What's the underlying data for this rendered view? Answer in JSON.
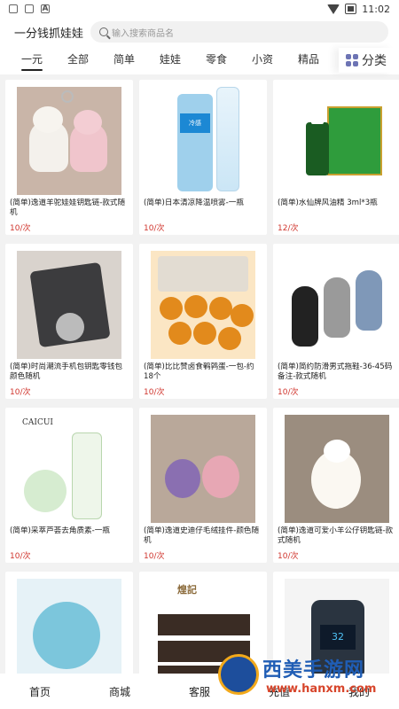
{
  "status_bar": {
    "time": "11:02"
  },
  "header": {
    "title": "一分钱抓娃娃",
    "search_placeholder": "输入搜索商品名"
  },
  "tabs": [
    {
      "label": "一元",
      "active": true
    },
    {
      "label": "全部",
      "active": false
    },
    {
      "label": "简单",
      "active": false
    },
    {
      "label": "娃娃",
      "active": false
    },
    {
      "label": "零食",
      "active": false
    },
    {
      "label": "小资",
      "active": false
    },
    {
      "label": "精品",
      "active": false
    }
  ],
  "category_button": {
    "label": "分类"
  },
  "products": [
    {
      "name": "(简单)逸道羊驼娃娃钥匙链-款式随机",
      "price": "10/次",
      "thumb": "alpaca"
    },
    {
      "name": "(简单)日本清凉降温喷雾-一瓶",
      "price": "10/次",
      "thumb": "spray",
      "thumb_text": "冷感"
    },
    {
      "name": "(简单)水仙牌风油精 3ml*3瓶",
      "price": "12/次",
      "thumb": "oil"
    },
    {
      "name": "(简单)时尚潮流手机包钥匙零钱包颜色随机",
      "price": "10/次",
      "thumb": "wallet"
    },
    {
      "name": "(简单)比比赞卤食鹌鹑蛋-一包-约18个",
      "price": "10/次",
      "thumb": "eggs"
    },
    {
      "name": "(简单)简约防滑男式拖鞋-36-45码备注-款式随机",
      "price": "10/次",
      "thumb": "slipper"
    },
    {
      "name": "(简单)采萃芦荟去角质素-一瓶",
      "price": "10/次",
      "thumb": "cream",
      "thumb_text": "CAICUI"
    },
    {
      "name": "(简单)逸道史迪仔毛绒挂件-颜色随机",
      "price": "10/次",
      "thumb": "pendant"
    },
    {
      "name": "(简单)逸道可爱小羊公仔钥匙链-款式随机",
      "price": "10/次",
      "thumb": "sheep"
    },
    {
      "name": "",
      "price": "",
      "thumb": "toy"
    },
    {
      "name": "",
      "price": "",
      "thumb": "tea",
      "thumb_text": "煌記"
    },
    {
      "name": "",
      "price": "",
      "thumb": "car",
      "thumb_text": "32"
    }
  ],
  "bottom_nav": [
    {
      "label": "首页"
    },
    {
      "label": "商城"
    },
    {
      "label": "客服"
    },
    {
      "label": "充值"
    },
    {
      "label": "我的"
    }
  ],
  "watermark": {
    "title": "西美手游网",
    "url": "www.hanxm.com"
  },
  "colors": {
    "price": "#d0342c",
    "category_icon": "#6d74b4",
    "background": "#f2f2f2"
  }
}
